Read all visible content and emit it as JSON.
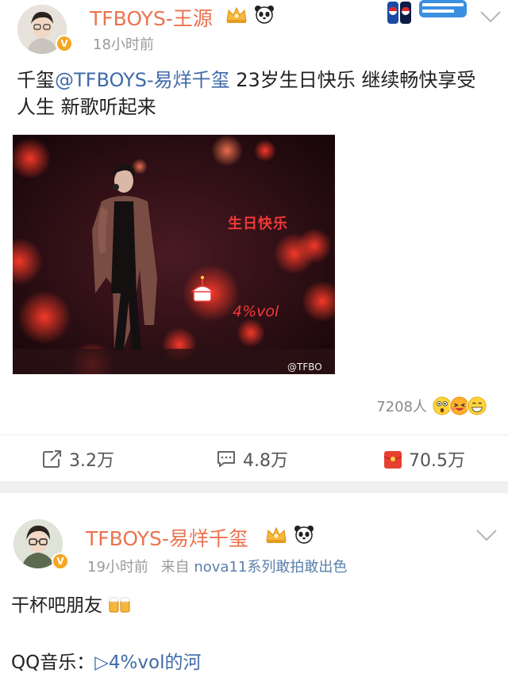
{
  "post1": {
    "username": "TFBOYS-王源",
    "timestamp": "18小时前",
    "content_prefix": "千玺",
    "mention": "@TFBOYS-易烊千玺",
    "content_suffix": " 23岁生日快乐 继续畅快享受人生 新歌听起来",
    "image_overlay_text": "生日快乐",
    "image_overlay_vol": "4%vol",
    "image_watermark": "@TFBO",
    "likes": "7208人",
    "actions": {
      "repost": "3.2万",
      "comment": "4.8万",
      "like": "70.5万"
    }
  },
  "post2": {
    "username": "TFBOYS-易烊千玺",
    "timestamp": "19小时前",
    "source_prefix": "来自",
    "source": "nova11系列敢拍敢出色",
    "content": "干杯吧朋友",
    "qq_label": "QQ音乐：",
    "qq_link": "▷4%vol的河"
  },
  "colors": {
    "username": "#eb7350",
    "link": "#3f6aa8",
    "badge": "#f5a623",
    "like_red": "#e8402f"
  },
  "icons": [
    "crown-vip-icon",
    "panda-icon",
    "chevron-down-icon",
    "repost-icon",
    "comment-icon",
    "like-icon",
    "verified-badge-icon",
    "beer-emoji-icon"
  ]
}
